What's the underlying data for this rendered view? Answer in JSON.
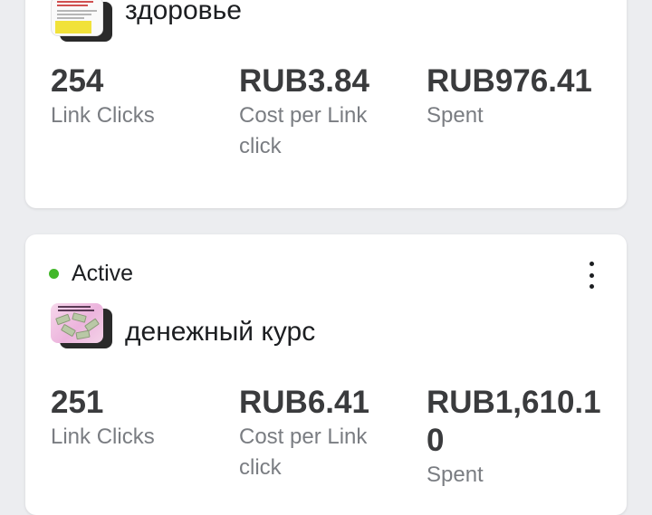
{
  "campaigns": [
    {
      "thumbnail_icon": "ad-thumbnail-icon",
      "name": "здоровье",
      "metrics": [
        {
          "value": "254",
          "label": "Link Clicks"
        },
        {
          "value": "RUB3.84",
          "label": "Cost per Link click"
        },
        {
          "value": "RUB976.41",
          "label": "Spent"
        }
      ]
    },
    {
      "status": "Active",
      "status_color": "#42b72a",
      "menu_icon": "more-vertical-icon",
      "thumbnail_icon": "ad-thumbnail-icon",
      "name": "денежный курс",
      "metrics": [
        {
          "value": "251",
          "label": "Link Clicks"
        },
        {
          "value": "RUB6.41",
          "label": "Cost per Link click"
        },
        {
          "value": "RUB1,610.10",
          "label": "Spent"
        }
      ]
    }
  ]
}
